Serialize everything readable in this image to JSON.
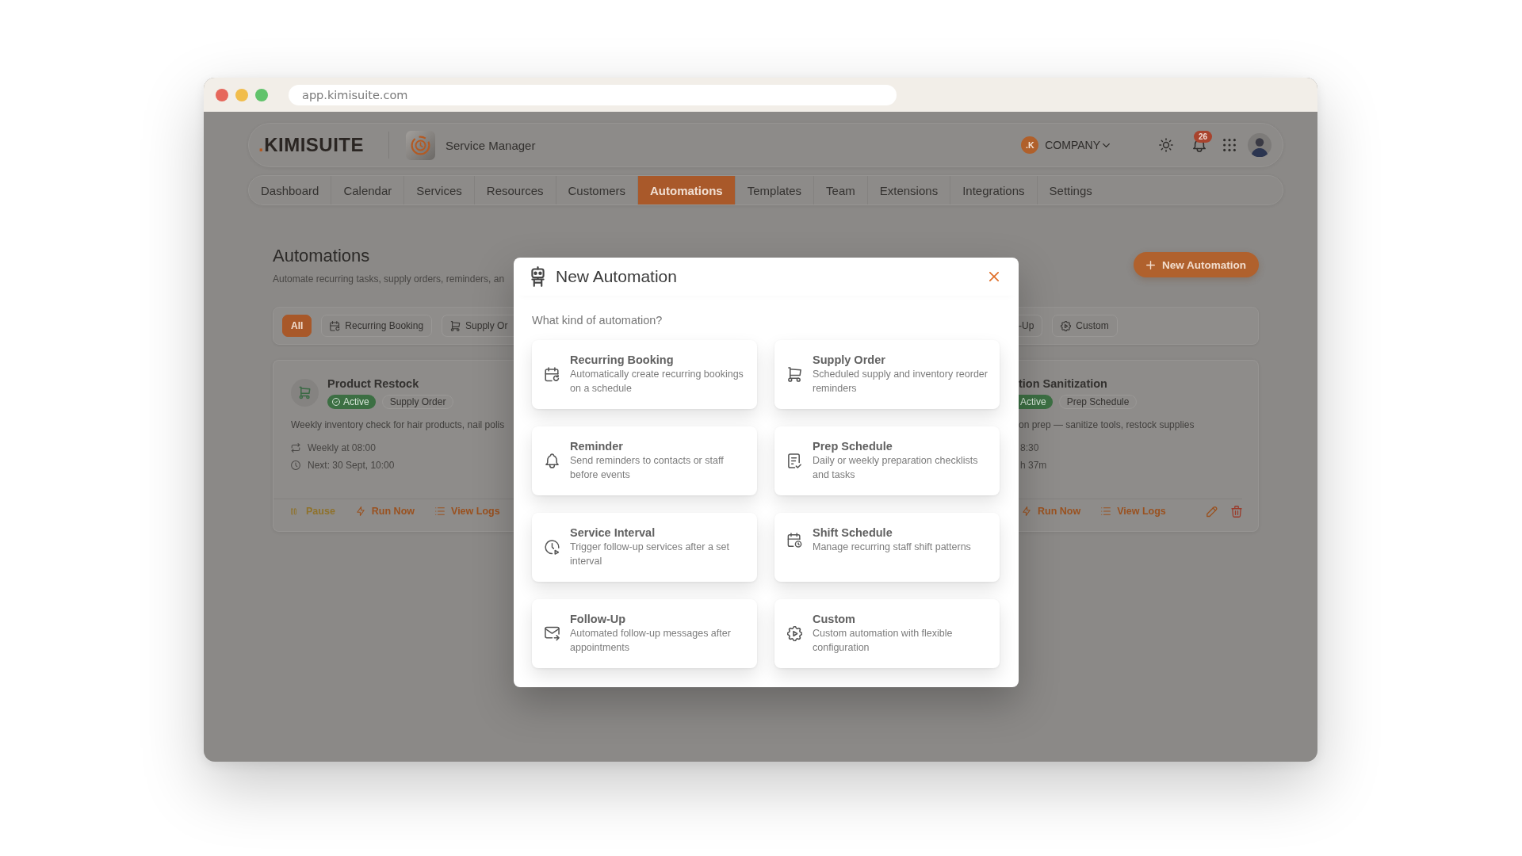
{
  "browser": {
    "url": "app.kimisuite.com"
  },
  "header": {
    "logo_dot": ".",
    "logo_name": "KIMISUITE",
    "app_name": "Service Manager",
    "company_initials": ".K",
    "company_name": "COMPANY",
    "notification_count": "26"
  },
  "nav": {
    "tabs": [
      {
        "label": "Dashboard",
        "selected": false
      },
      {
        "label": "Calendar",
        "selected": false
      },
      {
        "label": "Services",
        "selected": false
      },
      {
        "label": "Resources",
        "selected": false
      },
      {
        "label": "Customers",
        "selected": false
      },
      {
        "label": "Automations",
        "selected": true
      },
      {
        "label": "Templates",
        "selected": false
      },
      {
        "label": "Team",
        "selected": false
      },
      {
        "label": "Extensions",
        "selected": false
      },
      {
        "label": "Integrations",
        "selected": false
      },
      {
        "label": "Settings",
        "selected": false
      }
    ]
  },
  "page": {
    "title": "Automations",
    "subtitle": "Automate recurring tasks, supply orders, reminders, an",
    "new_button": "New Automation"
  },
  "filters": {
    "left": [
      {
        "label": "All",
        "kind": "text",
        "selected": true
      },
      {
        "label": "Recurring Booking",
        "kind": "booking",
        "selected": false
      },
      {
        "label": "Supply Or",
        "kind": "supply",
        "selected": false
      }
    ],
    "right": [
      {
        "label": "-Up",
        "kind": "text",
        "selected": false
      },
      {
        "label": "Custom",
        "kind": "custom",
        "selected": false
      }
    ]
  },
  "card_left": {
    "kind": "supply",
    "title": "Product Restock",
    "status": "Active",
    "tag": "Supply Order",
    "description": "Weekly inventory check for hair products, nail polis",
    "schedule": "Weekly at 08:00",
    "next_run": "Next: 30 Sept, 10:00",
    "actions": [
      {
        "kind": "pause",
        "label": "Pause"
      },
      {
        "kind": "run",
        "label": "Run Now"
      },
      {
        "kind": "logs",
        "label": "View Logs"
      }
    ]
  },
  "card_right": {
    "title": "tion Sanitization",
    "status": "Active",
    "tag": "Prep Schedule",
    "description": "on prep — sanitize tools, restock supplies",
    "schedule": "8:30",
    "next_run": "h 37m",
    "actions": [
      {
        "kind": "run",
        "label": "Run Now"
      },
      {
        "kind": "logs",
        "label": "View Logs"
      }
    ]
  },
  "modal": {
    "title": "New Automation",
    "prompt": "What kind of automation?",
    "options": [
      {
        "kind": "booking",
        "title": "Recurring Booking",
        "description": "Automatically create recurring bookings on a schedule"
      },
      {
        "kind": "supply",
        "title": "Supply Order",
        "description": "Scheduled supply and inventory reorder reminders"
      },
      {
        "kind": "reminder",
        "title": "Reminder",
        "description": "Send reminders to contacts or staff before events"
      },
      {
        "kind": "prep",
        "title": "Prep Schedule",
        "description": "Daily or weekly preparation checklists and tasks"
      },
      {
        "kind": "interval",
        "title": "Service Interval",
        "description": "Trigger follow-up services after a set interval"
      },
      {
        "kind": "shift",
        "title": "Shift Schedule",
        "description": "Manage recurring staff shift patterns"
      },
      {
        "kind": "followup",
        "title": "Follow-Up",
        "description": "Automated follow-up messages after appointments"
      },
      {
        "kind": "custom",
        "title": "Custom",
        "description": "Custom automation with flexible configuration"
      }
    ]
  }
}
